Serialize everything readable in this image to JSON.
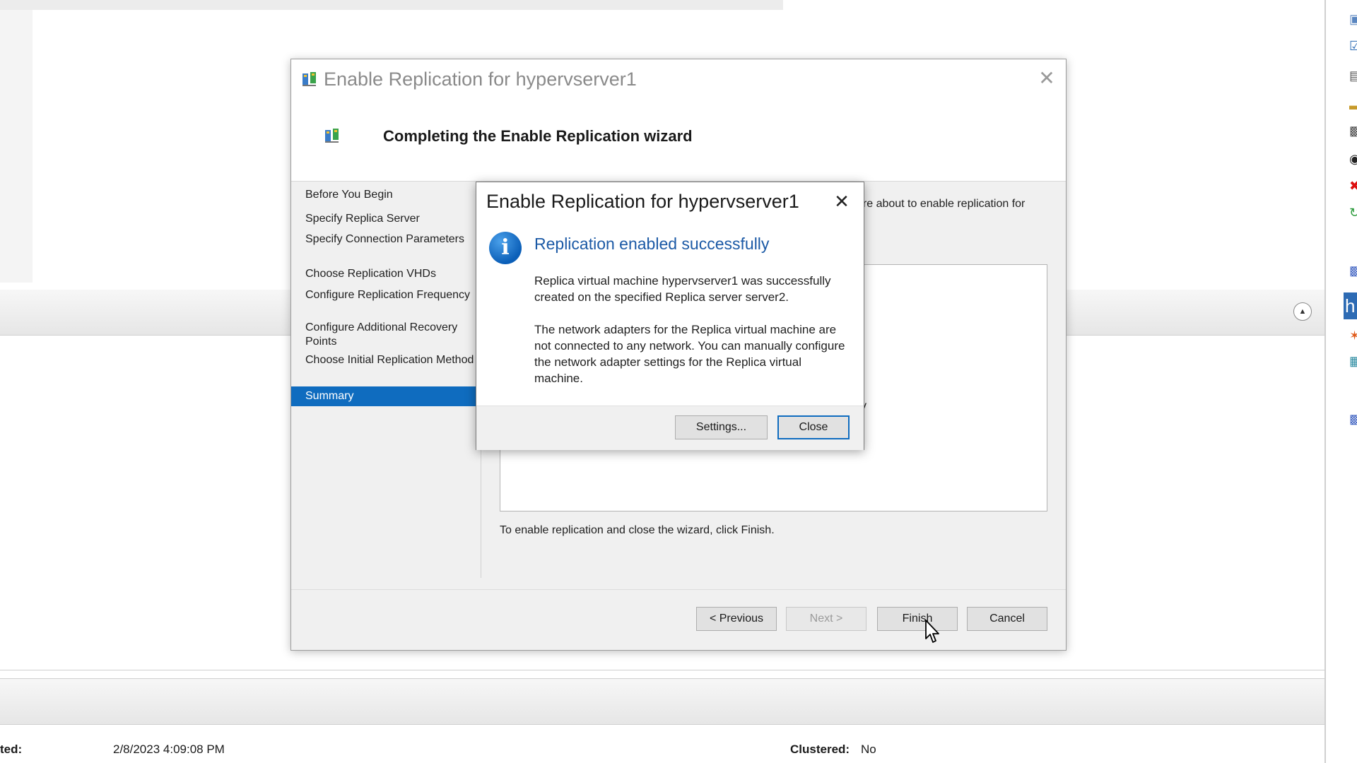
{
  "wizard": {
    "title": "Enable Replication for hypervserver1",
    "heading": "Completing the Enable Replication wizard",
    "steps": [
      "Before You Begin",
      "Specify Replica Server",
      "Specify Connection Parameters",
      "Choose Replication VHDs",
      "Configure Replication Frequency",
      "Configure Additional Recovery Points",
      "Choose Initial Replication Method",
      "Summary"
    ],
    "selected_step": "Summary",
    "intro_fragment": "are about to enable replication for",
    "obscured_fragment": "y",
    "finish_instruction": "To enable replication and close the wizard, click Finish.",
    "buttons": {
      "previous": "< Previous",
      "next": "Next >",
      "finish": "Finish",
      "cancel": "Cancel"
    }
  },
  "message_box": {
    "title": "Enable Replication for hypervserver1",
    "heading": "Replication enabled successfully",
    "paragraph1": "Replica virtual machine hypervserver1 was successfully created on the specified Replica server server2.",
    "paragraph2": "The network adapters for the Replica virtual machine are not connected to any network. You can manually configure the network adapter settings for the Replica virtual machine.",
    "buttons": {
      "settings": "Settings...",
      "close": "Close"
    }
  },
  "details": {
    "created_label": "ted:",
    "created_value": "2/8/2023 4:09:08 PM",
    "clustered_label": "Clustered:",
    "clustered_value": "No"
  },
  "colors": {
    "selection": "#0f6cbf",
    "heading_blue": "#1c5aa6",
    "info_icon": "#0b5fb8"
  }
}
